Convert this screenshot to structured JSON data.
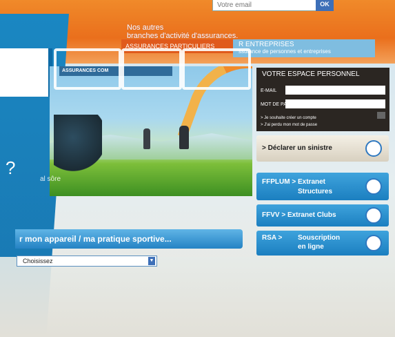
{
  "header": {
    "email_placeholder": "Votre email",
    "ok_label": "OK",
    "autres_line1": "Nos autres",
    "autres_line2": "branches d'activité d'assurances.",
    "entreprises_title": "R ENTREPRISES",
    "entreprises_sub": "ssurance de personnes et entreprises",
    "particuliers_label": "ASSURANCES PARTICULIERS"
  },
  "left": {
    "question": "?"
  },
  "photo": {
    "assurances_bar": "ASSURANCES COM",
    "caption": "al sôre"
  },
  "espace": {
    "title": "VOTRE ESPACE PERSONNEL",
    "email_label": "E-MAIL",
    "password_label": "MOT DE PASSE",
    "link1": "> Je souhaite créer un compte",
    "link2": "> J'ai perdu mon mot de passe"
  },
  "buttons": {
    "declarer": "> Déclarer un sinistre",
    "ffplum_prefix": "FFPLUM >",
    "ffplum_line1": "Extranet",
    "ffplum_line2": "Structures",
    "ffvv": "FFVV > Extranet Clubs",
    "rsa_prefix": "RSA >",
    "rsa_line1": "Souscription",
    "rsa_line2": "en ligne"
  },
  "pratique": {
    "label": "r mon appareil / ma pratique sportive...",
    "select_value": "Choisissez"
  },
  "colors": {
    "orange": "#ea6f1c",
    "blue": "#1b7fc0",
    "dark": "#2b2622"
  }
}
